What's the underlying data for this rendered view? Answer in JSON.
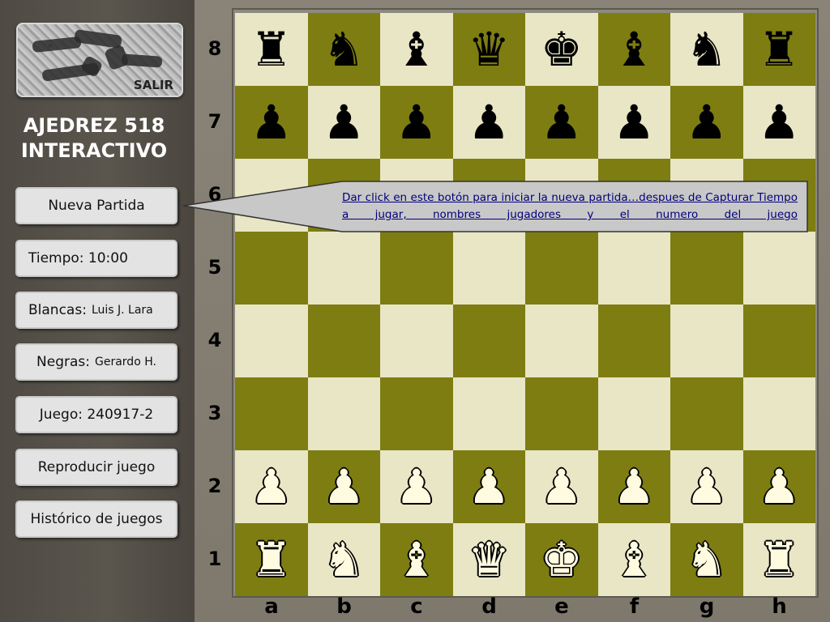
{
  "app": {
    "title_line1": "AJEDREZ 518",
    "title_line2": "INTERACTIVO",
    "exit_label": "SALIR"
  },
  "sidebar": {
    "new_game": "Nueva Partida",
    "time_label": "Tiempo: 10:00",
    "white_label": "Blancas:",
    "white_name": "Luis J. Lara",
    "black_label": "Negras:",
    "black_name": "Gerardo H.",
    "game_label": "Juego: 240917-2",
    "replay": "Reproducir juego",
    "history": "Histórico de juegos"
  },
  "tooltip": {
    "text": "Dar click en este botón para iniciar la nueva partida…despues de Capturar Tiempo a jugar, nombres jugadores y el numero del juego"
  },
  "board": {
    "ranks": [
      "8",
      "7",
      "6",
      "5",
      "4",
      "3",
      "2",
      "1"
    ],
    "files": [
      "a",
      "b",
      "c",
      "d",
      "e",
      "f",
      "g",
      "h"
    ],
    "colors": {
      "light": "#e9e6c5",
      "dark": "#7d7d12"
    },
    "position": [
      [
        "br",
        "bn",
        "bb",
        "bq",
        "bk",
        "bb",
        "bn",
        "br"
      ],
      [
        "bp",
        "bp",
        "bp",
        "bp",
        "bp",
        "bp",
        "bp",
        "bp"
      ],
      [
        "",
        "",
        "",
        "",
        "",
        "",
        "",
        ""
      ],
      [
        "",
        "",
        "",
        "",
        "",
        "",
        "",
        ""
      ],
      [
        "",
        "",
        "",
        "",
        "",
        "",
        "",
        ""
      ],
      [
        "",
        "",
        "",
        "",
        "",
        "",
        "",
        ""
      ],
      [
        "wp",
        "wp",
        "wp",
        "wp",
        "wp",
        "wp",
        "wp",
        "wp"
      ],
      [
        "wr",
        "wn",
        "wb",
        "wq",
        "wk",
        "wb",
        "wn",
        "wr"
      ]
    ]
  }
}
